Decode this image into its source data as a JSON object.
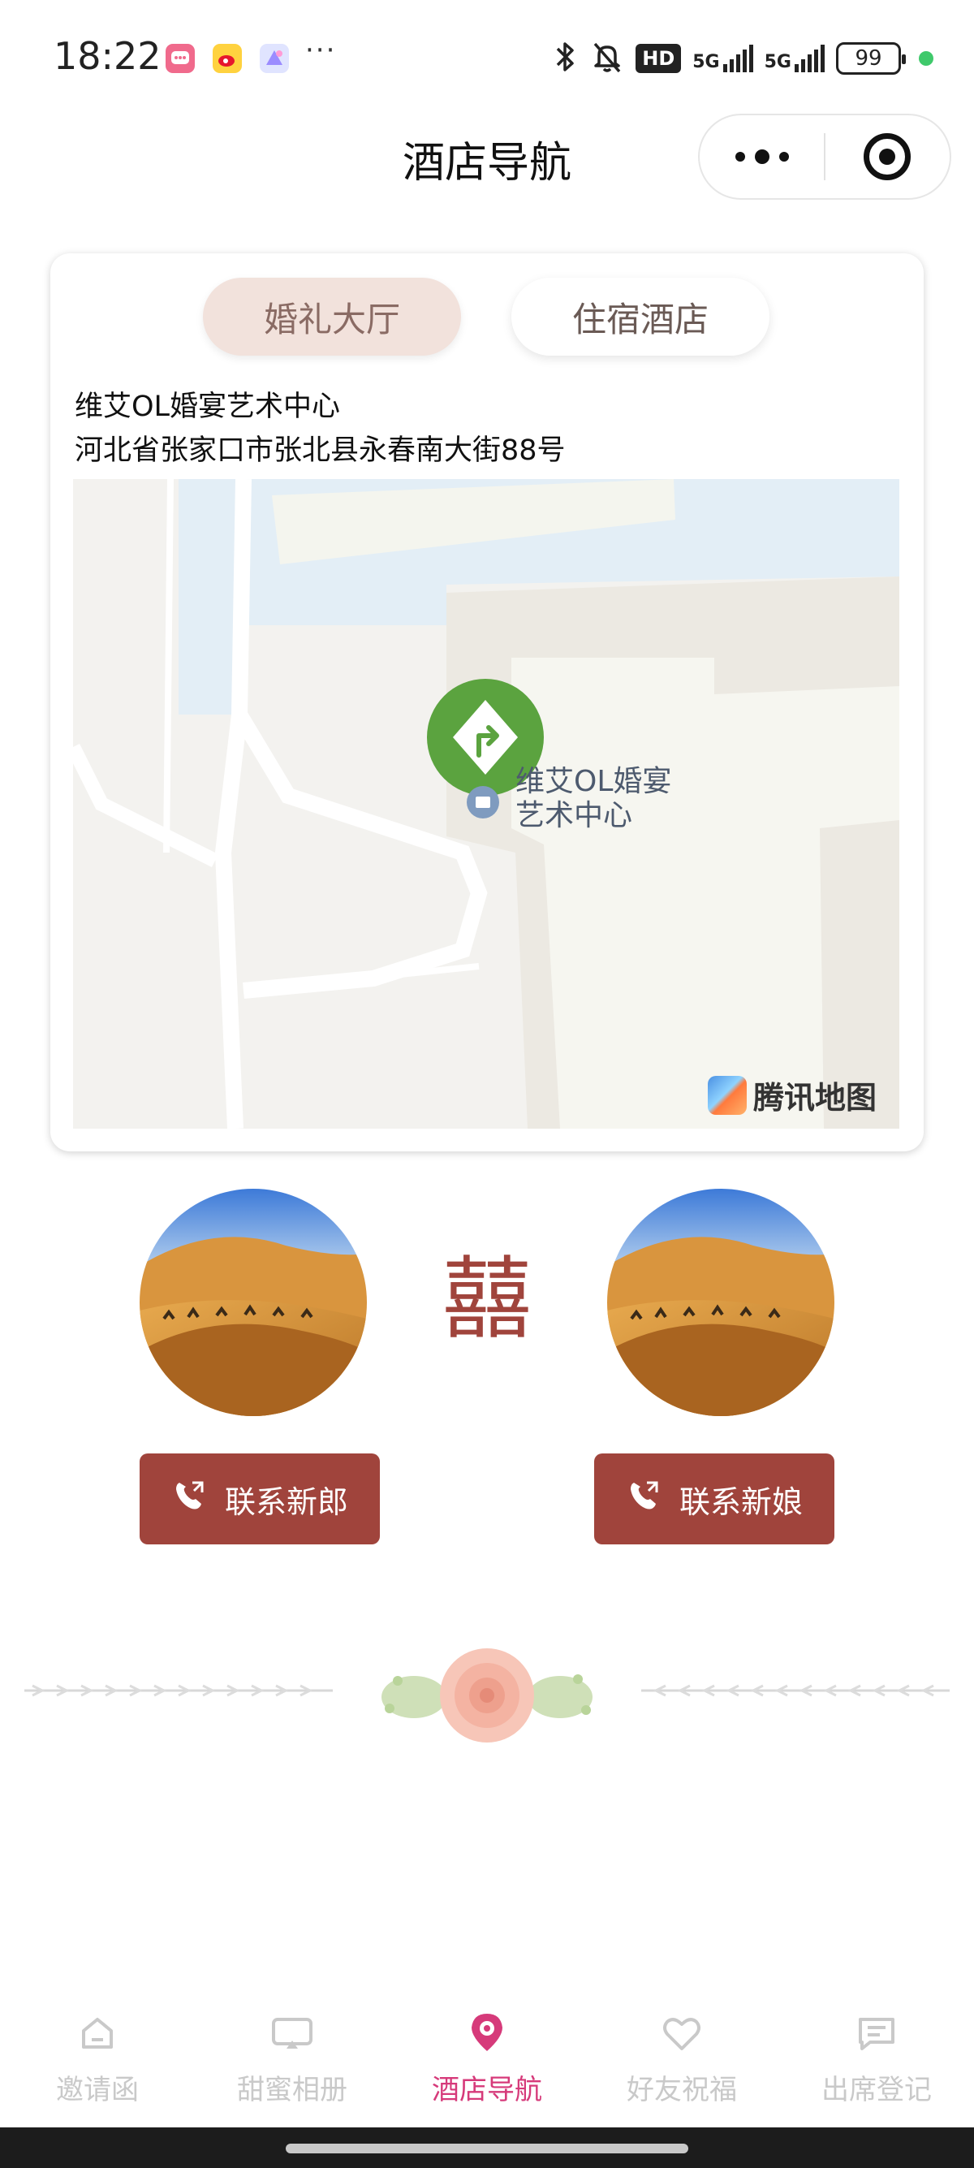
{
  "status_bar": {
    "time": "18:22",
    "network_1": "5G",
    "network_2": "5G",
    "hd_badge": "HD",
    "battery": "99",
    "dots": "···",
    "icons": [
      "message-app-icon",
      "weibo-app-icon",
      "gallery-app-icon",
      "bluetooth-icon",
      "mute-bell-icon"
    ]
  },
  "header": {
    "title": "酒店导航",
    "more_button": "more-dots-icon",
    "close_button": "mini-program-close-icon"
  },
  "venue": {
    "tabs": [
      {
        "label": "婚礼大厅",
        "active": true
      },
      {
        "label": "住宿酒店",
        "active": false
      }
    ],
    "name": "维艾OL婚宴艺术中心",
    "address": "河北省张家口市张北县永春南大街88号",
    "map": {
      "poi_label_line1": "维艾OL婚宴",
      "poi_label_line2": "艺术中心",
      "provider": "腾讯地图",
      "marker_icon": "navigation-marker-icon"
    }
  },
  "couple": {
    "xi_symbol": "囍",
    "groom_photo": "desert-camels-photo",
    "bride_photo": "desert-camels-photo",
    "contact_groom": "联系新郎",
    "contact_bride": "联系新娘",
    "contact_icon": "phone-icon"
  },
  "tabbar": {
    "items": [
      {
        "label": "邀请函",
        "icon": "home-icon",
        "active": false
      },
      {
        "label": "甜蜜相册",
        "icon": "photo-album-icon",
        "active": false
      },
      {
        "label": "酒店导航",
        "icon": "location-pin-icon",
        "active": true
      },
      {
        "label": "好友祝福",
        "icon": "heart-icon",
        "active": false
      },
      {
        "label": "出席登记",
        "icon": "message-icon",
        "active": false
      }
    ]
  },
  "colors": {
    "accent": "#a0443c",
    "tab_active_bg": "#f2e2dc",
    "tabbar_active": "#d63a7a",
    "tabbar_inactive": "#c9c9c9",
    "map_marker": "#5ba33f"
  }
}
